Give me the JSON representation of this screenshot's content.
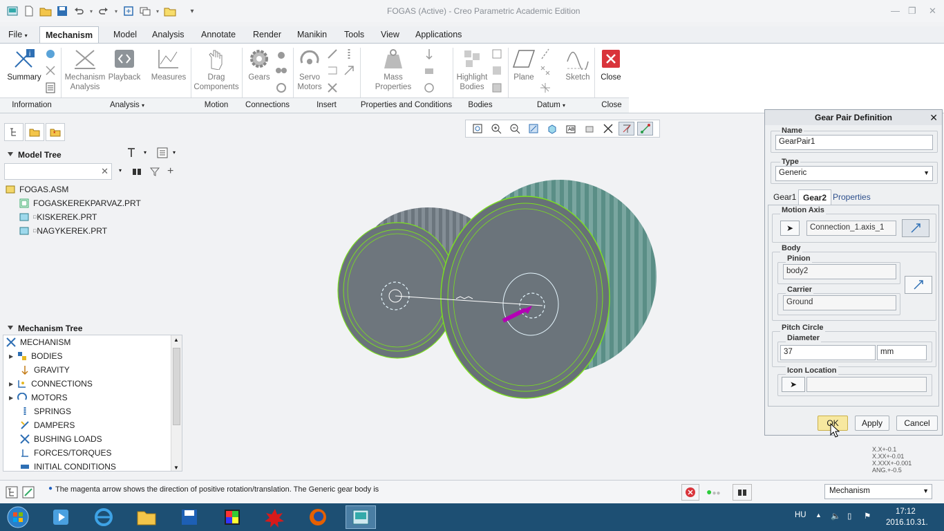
{
  "window": {
    "title": "FOGAS (Active) - Creo Parametric Academic Edition"
  },
  "menu_tabs": [
    {
      "label": "File",
      "dropdown": true
    },
    {
      "label": "Mechanism",
      "active": true
    },
    {
      "label": "Model"
    },
    {
      "label": "Analysis"
    },
    {
      "label": "Annotate"
    },
    {
      "label": "Render"
    },
    {
      "label": "Manikin"
    },
    {
      "label": "Tools"
    },
    {
      "label": "View"
    },
    {
      "label": "Applications"
    }
  ],
  "ribbon": {
    "summary": "Summary",
    "mechanism_analysis": "Mechanism Analysis",
    "playback": "Playback",
    "measures": "Measures",
    "drag_components": "Drag Components",
    "gears": "Gears",
    "servo_motors": "Servo Motors",
    "mass_properties": "Mass Properties",
    "highlight_bodies": "Highlight Bodies",
    "plane": "Plane",
    "sketch": "Sketch",
    "close": "Close",
    "groups": {
      "information": "Information",
      "analysis": "Analysis",
      "motion": "Motion",
      "connections": "Connections",
      "insert": "Insert",
      "properties": "Properties and Conditions",
      "bodies": "Bodies",
      "datum": "Datum",
      "close": "Close"
    }
  },
  "model_tree": {
    "header": "Model Tree",
    "search_placeholder": "",
    "items": [
      {
        "label": "FOGAS.ASM"
      },
      {
        "label": "FOGASKEREKPARVAZ.PRT"
      },
      {
        "label": "KISKEREK.PRT"
      },
      {
        "label": "NAGYKEREK.PRT"
      }
    ]
  },
  "mechanism_tree": {
    "header": "Mechanism Tree",
    "items": [
      {
        "label": "MECHANISM"
      },
      {
        "label": "BODIES"
      },
      {
        "label": "GRAVITY"
      },
      {
        "label": "CONNECTIONS"
      },
      {
        "label": "MOTORS"
      },
      {
        "label": "SPRINGS"
      },
      {
        "label": "DAMPERS"
      },
      {
        "label": "BUSHING LOADS"
      },
      {
        "label": "FORCES/TORQUES"
      },
      {
        "label": "INITIAL CONDITIONS"
      }
    ]
  },
  "dialog": {
    "title": "Gear Pair Definition",
    "name_label": "Name",
    "name_value": "GearPair1",
    "type_label": "Type",
    "type_value": "Generic",
    "tabs": [
      "Gear1",
      "Gear2",
      "Properties"
    ],
    "motion_axis_label": "Motion Axis",
    "motion_axis_value": "Connection_1.axis_1",
    "body_label": "Body",
    "pinion_label": "Pinion",
    "pinion_value": "body2",
    "carrier_label": "Carrier",
    "carrier_value": "Ground",
    "pitch_circle_label": "Pitch Circle",
    "diameter_label": "Diameter",
    "diameter_value": "37",
    "diameter_unit": "mm",
    "icon_location_label": "Icon Location",
    "icon_location_value": "",
    "ok": "OK",
    "apply": "Apply",
    "cancel": "Cancel"
  },
  "tolerances": [
    "X.X+-0.1",
    "X.XX+-0.01",
    "X.XXX+-0.001",
    "ANG.+-0.5"
  ],
  "status": {
    "message": "The magenta arrow shows the direction of positive rotation/translation. The Generic gear body is",
    "filter_value": "Mechanism"
  },
  "taskbar": {
    "language": "HU",
    "time": "17:12",
    "date": "2016.10.31."
  },
  "colors": {
    "accent": "#1d4f73",
    "close_red": "#d9343b",
    "gear_green": "#7be01f",
    "gear_gray": "#5d6770"
  }
}
